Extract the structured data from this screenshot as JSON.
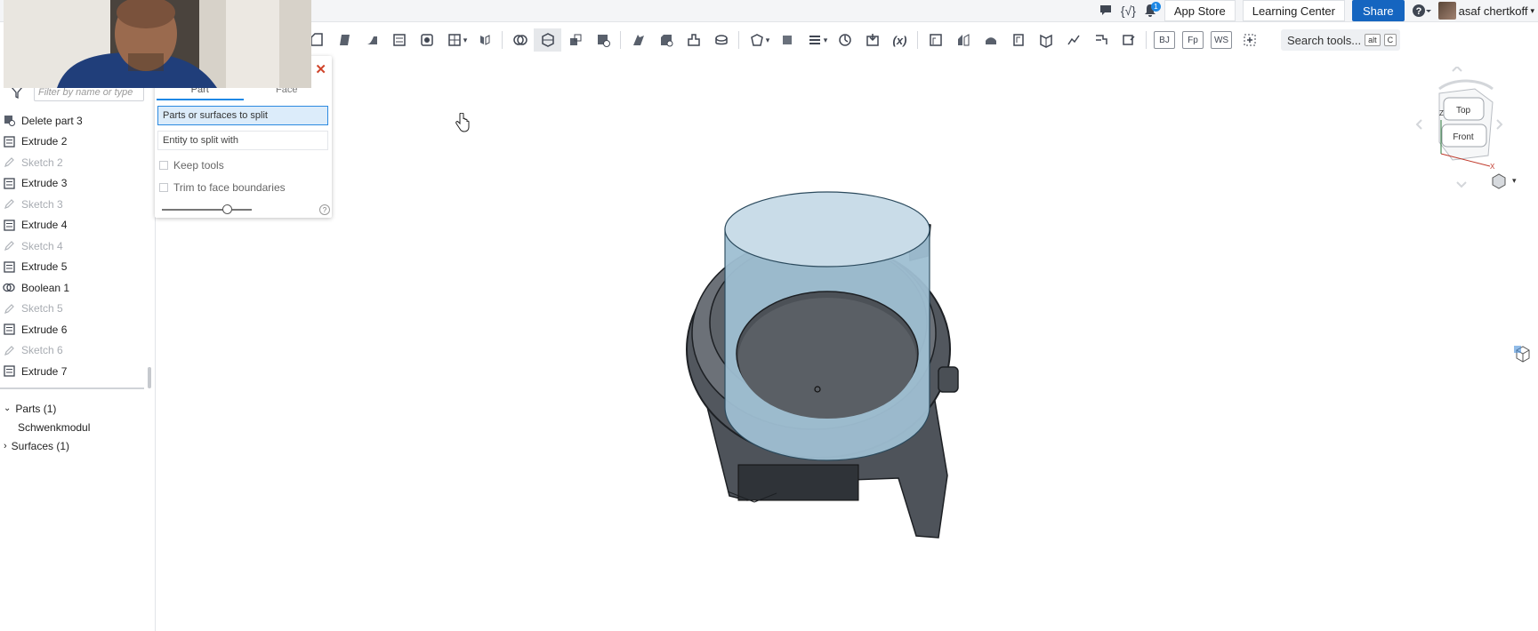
{
  "top_right": {
    "chat_icon": "speech-bubble-icon",
    "variables_label": "{√}",
    "notifications_count": "1",
    "app_store": "App Store",
    "learning_center": "Learning Center",
    "share": "Share",
    "help_label": "?",
    "user_name": "asaf chertkoff"
  },
  "toolbar": {
    "search_label": "Search tools...",
    "search_kbd1": "alt",
    "search_kbd2": "C",
    "variable_label": "(x)",
    "bj_label": "BJ",
    "fp_label": "Fp",
    "ws_label": "WS"
  },
  "feature_tree": {
    "filter_placeholder": "Filter by name or type",
    "items": [
      {
        "label": "Delete part 3",
        "kind": "feature",
        "icon": "delete-part-icon"
      },
      {
        "label": "Extrude 2",
        "kind": "feature",
        "icon": "extrude-icon"
      },
      {
        "label": "Sketch 2",
        "kind": "sketch",
        "icon": "sketch-pencil-icon"
      },
      {
        "label": "Extrude 3",
        "kind": "feature",
        "icon": "extrude-icon"
      },
      {
        "label": "Sketch 3",
        "kind": "sketch",
        "icon": "sketch-pencil-icon"
      },
      {
        "label": "Extrude 4",
        "kind": "feature",
        "icon": "extrude-icon"
      },
      {
        "label": "Sketch 4",
        "kind": "sketch",
        "icon": "sketch-pencil-icon"
      },
      {
        "label": "Extrude 5",
        "kind": "feature",
        "icon": "extrude-icon"
      },
      {
        "label": "Boolean 1",
        "kind": "feature",
        "icon": "boolean-icon"
      },
      {
        "label": "Sketch 5",
        "kind": "sketch",
        "icon": "sketch-pencil-icon"
      },
      {
        "label": "Extrude 6",
        "kind": "feature",
        "icon": "extrude-icon"
      },
      {
        "label": "Sketch 6",
        "kind": "sketch",
        "icon": "sketch-pencil-icon"
      },
      {
        "label": "Extrude 7",
        "kind": "feature",
        "icon": "extrude-icon"
      }
    ]
  },
  "parts": {
    "parts_header": "Parts (1)",
    "part_name": "Schwenkmodul",
    "surfaces_header": "Surfaces (1)"
  },
  "split_dialog": {
    "tab_part": "Part",
    "tab_face": "Face",
    "field_parts": "Parts or surfaces to split",
    "field_entity": "Entity to split with",
    "keep_tools": "Keep tools",
    "trim_to_face": "Trim to face boundaries",
    "help": "?",
    "close_icon": "close-x-icon"
  },
  "view_cube": {
    "top": "Top",
    "front": "Front",
    "axis_z": "Z",
    "axis_x": "X"
  },
  "colors": {
    "accent": "#1565c0",
    "highlight_field": "#dcecfa",
    "model_surface": "#8fb3c8",
    "model_body": "#555a60"
  }
}
